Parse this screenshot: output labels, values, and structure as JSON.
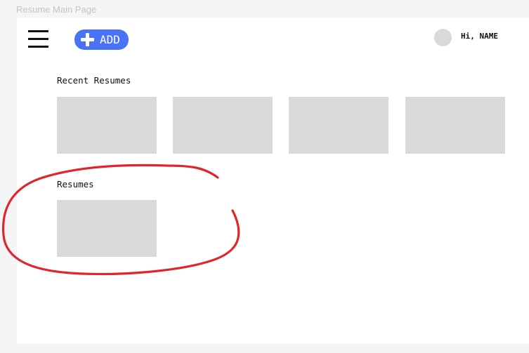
{
  "frame": {
    "label": "Resume Main Page"
  },
  "header": {
    "menu_icon": "hamburger-menu-icon",
    "add_button": {
      "label": "ADD",
      "icon": "plus-icon",
      "color": "#4a72f5"
    },
    "user": {
      "greeting": "Hi, NAME"
    }
  },
  "recent": {
    "title": "Recent Resumes",
    "cards": [
      "",
      "",
      "",
      ""
    ]
  },
  "resumes": {
    "title": "Resumes",
    "cards": [
      ""
    ]
  },
  "colors": {
    "placeholder": "#d9d9d9",
    "annotation": "#e0262a",
    "background": "#f5f5f5"
  }
}
